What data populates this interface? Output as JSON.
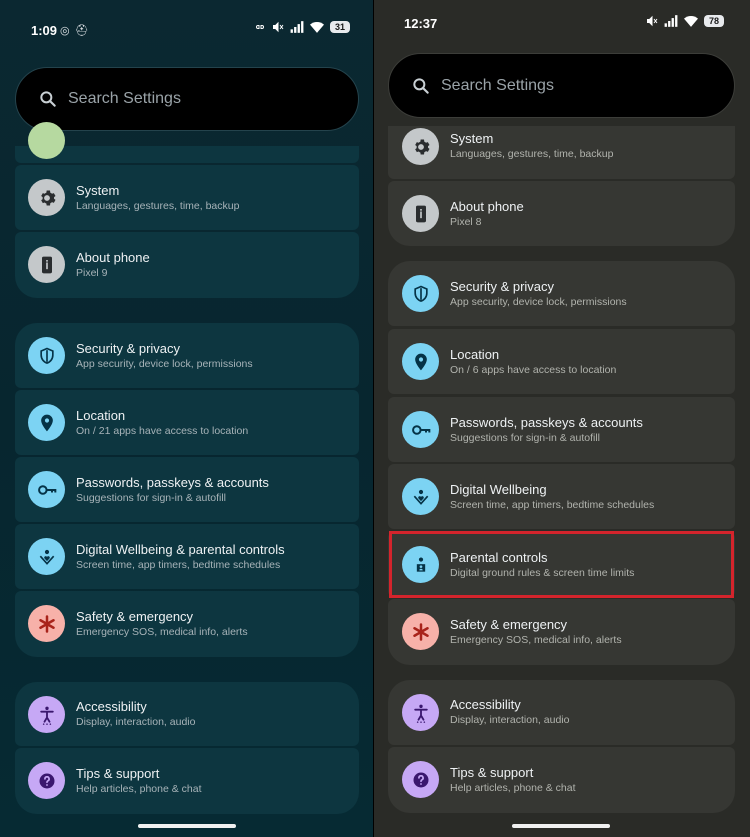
{
  "left_phone": {
    "status": {
      "time": "1:09",
      "extra": "◎ ⛑",
      "battery": "31"
    },
    "search_placeholder": "Search Settings",
    "items": [
      {
        "key": "system",
        "title": "System",
        "subtitle": "Languages, gestures, time, backup",
        "icon": "gear-icon"
      },
      {
        "key": "about",
        "title": "About phone",
        "subtitle": "Pixel 9",
        "icon": "phone-info-icon"
      },
      {
        "key": "security",
        "title": "Security & privacy",
        "subtitle": "App security, device lock, permissions",
        "icon": "shield-icon"
      },
      {
        "key": "location",
        "title": "Location",
        "subtitle": "On / 21 apps have access to location",
        "icon": "location-pin-icon"
      },
      {
        "key": "passwords",
        "title": "Passwords, passkeys & accounts",
        "subtitle": "Suggestions for sign-in & autofill",
        "icon": "key-icon"
      },
      {
        "key": "wellbeing",
        "title": "Digital Wellbeing & parental controls",
        "subtitle": "Screen time, app timers, bedtime schedules",
        "icon": "wellbeing-heart-icon"
      },
      {
        "key": "safety",
        "title": "Safety & emergency",
        "subtitle": "Emergency SOS, medical info, alerts",
        "icon": "asterisk-icon"
      },
      {
        "key": "accessibility",
        "title": "Accessibility",
        "subtitle": "Display, interaction, audio",
        "icon": "accessibility-icon"
      },
      {
        "key": "tips",
        "title": "Tips & support",
        "subtitle": "Help articles, phone & chat",
        "icon": "question-icon"
      }
    ]
  },
  "right_phone": {
    "status": {
      "time": "12:37",
      "battery": "78"
    },
    "search_placeholder": "Search Settings",
    "items": [
      {
        "key": "system",
        "title": "System",
        "subtitle": "Languages, gestures, time, backup",
        "icon": "gear-icon"
      },
      {
        "key": "about",
        "title": "About phone",
        "subtitle": "Pixel 8",
        "icon": "phone-info-icon"
      },
      {
        "key": "security",
        "title": "Security & privacy",
        "subtitle": "App security, device lock, permissions",
        "icon": "shield-icon"
      },
      {
        "key": "location",
        "title": "Location",
        "subtitle": "On / 6 apps have access to location",
        "icon": "location-pin-icon"
      },
      {
        "key": "passwords",
        "title": "Passwords, passkeys & accounts",
        "subtitle": "Suggestions for sign-in & autofill",
        "icon": "key-icon"
      },
      {
        "key": "wellbeing",
        "title": "Digital Wellbeing",
        "subtitle": "Screen time, app timers, bedtime schedules",
        "icon": "wellbeing-heart-icon"
      },
      {
        "key": "parental",
        "title": "Parental controls",
        "subtitle": "Digital ground rules & screen time limits",
        "icon": "parental-icon"
      },
      {
        "key": "safety",
        "title": "Safety & emergency",
        "subtitle": "Emergency SOS, medical info, alerts",
        "icon": "asterisk-icon"
      },
      {
        "key": "accessibility",
        "title": "Accessibility",
        "subtitle": "Display, interaction, audio",
        "icon": "accessibility-icon"
      },
      {
        "key": "tips",
        "title": "Tips & support",
        "subtitle": "Help articles, phone & chat",
        "icon": "question-icon"
      }
    ]
  },
  "colors": {
    "left_background": "#07262f",
    "left_card": "#0d3640",
    "right_background": "#2a2b27",
    "right_card": "#363733",
    "highlight_border": "#d4242c",
    "icon_blue": "#7cd3f3",
    "icon_pink": "#f7b1a9",
    "icon_purple": "#c6a8f5",
    "icon_gray": "#c4c8ca"
  }
}
